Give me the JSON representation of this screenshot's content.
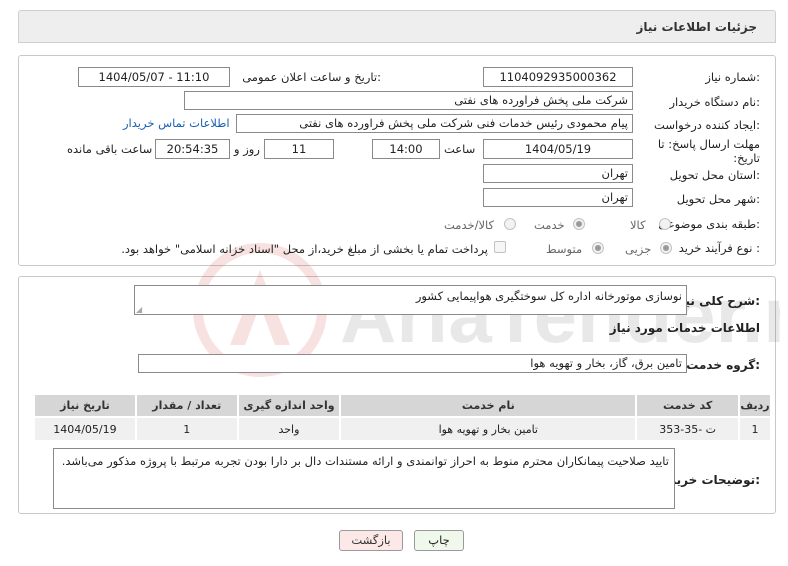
{
  "header": {
    "title": "جزئیات اطلاعات نیاز"
  },
  "fields": {
    "need_number_label": "شماره نیاز:",
    "need_number": "1104092935000362",
    "announce_label": "تاریخ و ساعت اعلان عمومی:",
    "announce_value": "1404/05/07 - 11:10",
    "buyer_org_label": "نام دستگاه خریدار:",
    "buyer_org": "شرکت ملی پخش فراورده های نفتی",
    "creator_label": "ایجاد کننده درخواست:",
    "creator": "پیام محمودی رئیس خدمات فنی  شرکت ملی پخش فراورده های نفتی",
    "contact_link": "اطلاعات تماس خریدار",
    "deadline_label": "مهلت ارسال پاسخ: تا تاریخ:",
    "deadline_date": "1404/05/19",
    "time_label": "ساعت",
    "deadline_time": "14:00",
    "days_value": "11",
    "days_label": "روز و",
    "remaining_time": "20:54:35",
    "remaining_label": "ساعت باقی مانده",
    "province_label": "استان محل تحویل:",
    "province": "تهران",
    "city_label": "شهر محل تحویل:",
    "city": "تهران",
    "category_label": "طبقه بندی موضوعی:",
    "category_options": [
      "کالا",
      "خدمت",
      "کالا/خدمت"
    ],
    "category_selected": "خدمت",
    "process_label": "نوع فرآیند خرید :",
    "process_options": [
      "جزیی",
      "متوسط"
    ],
    "process_selected": "جزیی",
    "payment_note": "پرداخت تمام یا بخشی از مبلغ خرید،از محل \"اسناد خزانه اسلامی\" خواهد بود."
  },
  "need": {
    "summary_label": "شرح کلی نیاز:",
    "summary": "نوسازی موتورخانه اداره کل سوختگیری هواپیمایی کشور",
    "services_heading": "اطلاعات خدمات مورد نیاز",
    "group_label": "گروه خدمت:",
    "group": "تامین برق، گاز، بخار و تهویه هوا"
  },
  "table": {
    "headers": [
      "ردیف",
      "کد خدمت",
      "نام خدمت",
      "واحد اندازه گیری",
      "تعداد / مقدار",
      "تاریخ نیاز"
    ],
    "rows": [
      [
        "1",
        "ت -35-353",
        "تامین بخار و تهویه هوا",
        "واحد",
        "1",
        "1404/05/19"
      ]
    ]
  },
  "buyer_notes": {
    "label": "توضیحات خریدار:",
    "text": "تایید صلاحیت پیمانکاران محترم منوط به احراز توانمندی و ارائه مستندات دال بر دارا بودن تجربه مرتبط با پروژه مذکور می‌باشد."
  },
  "buttons": {
    "print": "چاپ",
    "back": "بازگشت"
  },
  "watermark": "AriaTender.neT",
  "colors": {
    "link": "#1a5fb4",
    "back_bg": "#fde8e8",
    "print_bg": "#f0f8ec"
  }
}
